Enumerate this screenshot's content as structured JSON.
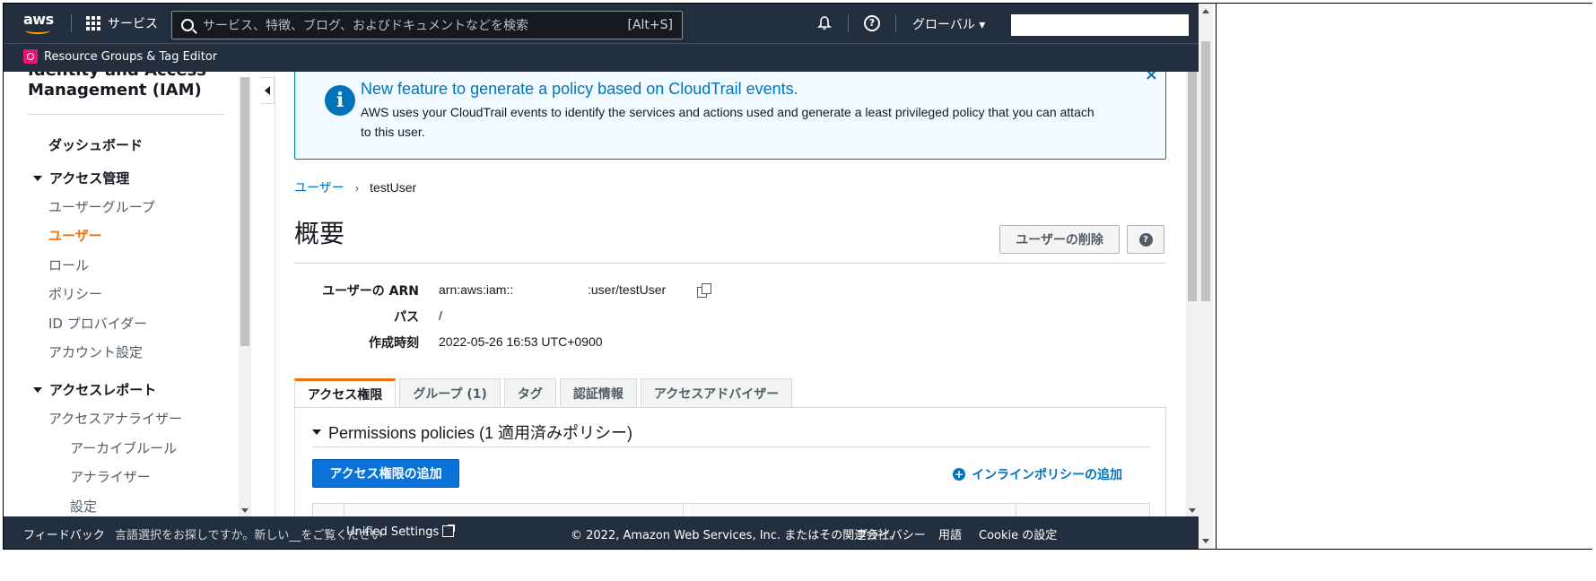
{
  "topnav": {
    "logo_text": "aws",
    "services_label": "サービス",
    "search_placeholder": "サービス、特徴、ブログ、およびドキュメントなどを検索",
    "search_shortcut": "[Alt+S]",
    "region_label": "グローバル ▾",
    "favorite": "Resource Groups & Tag Editor"
  },
  "sidebar": {
    "title": "Identity and Access Management (IAM)",
    "dashboard": "ダッシュボード",
    "section_access": "アクセス管理",
    "access_items": [
      "ユーザーグループ",
      "ユーザー",
      "ロール",
      "ポリシー",
      "ID プロバイダー",
      "アカウント設定"
    ],
    "section_reports": "アクセスレポート",
    "reports_items": [
      "アクセスアナライザー",
      "アーカイブルール",
      "アナライザー",
      "設定"
    ]
  },
  "flash": {
    "title": "New feature to generate a policy based on CloudTrail events.",
    "body": "AWS uses your CloudTrail events to identify the services and actions used and generate a least privileged policy that you can attach to this user.",
    "close": "×"
  },
  "breadcrumb": {
    "parent": "ユーザー",
    "separator": "›",
    "current": "testUser"
  },
  "page": {
    "title": "概要",
    "delete_button": "ユーザーの削除"
  },
  "summary": {
    "arn_label": "ユーザーの ARN",
    "arn_prefix": "arn:aws:iam::",
    "arn_suffix": ":user/testUser",
    "path_label": "パス",
    "path_value": "/",
    "created_label": "作成時刻",
    "created_value": "2022-05-26 16:53 UTC+0900"
  },
  "tabs": [
    "アクセス権限",
    "グループ (1)",
    "タグ",
    "認証情報",
    "アクセスアドバイザー"
  ],
  "permissions": {
    "heading": "Permissions policies (1 適用済みポリシー)",
    "add_button": "アクセス権限の追加",
    "inline_add": "インラインポリシーの追加"
  },
  "footer": {
    "feedback": "フィードバック",
    "lang_text": "言語選択をお探しですか。新しい__をご覧ください",
    "unified_settings": "Unified Settings",
    "copyright": "© 2022, Amazon Web Services, Inc. またはその関連会社。",
    "privacy": "プライバシー",
    "terms": "用語",
    "cookies": "Cookie の設定"
  }
}
